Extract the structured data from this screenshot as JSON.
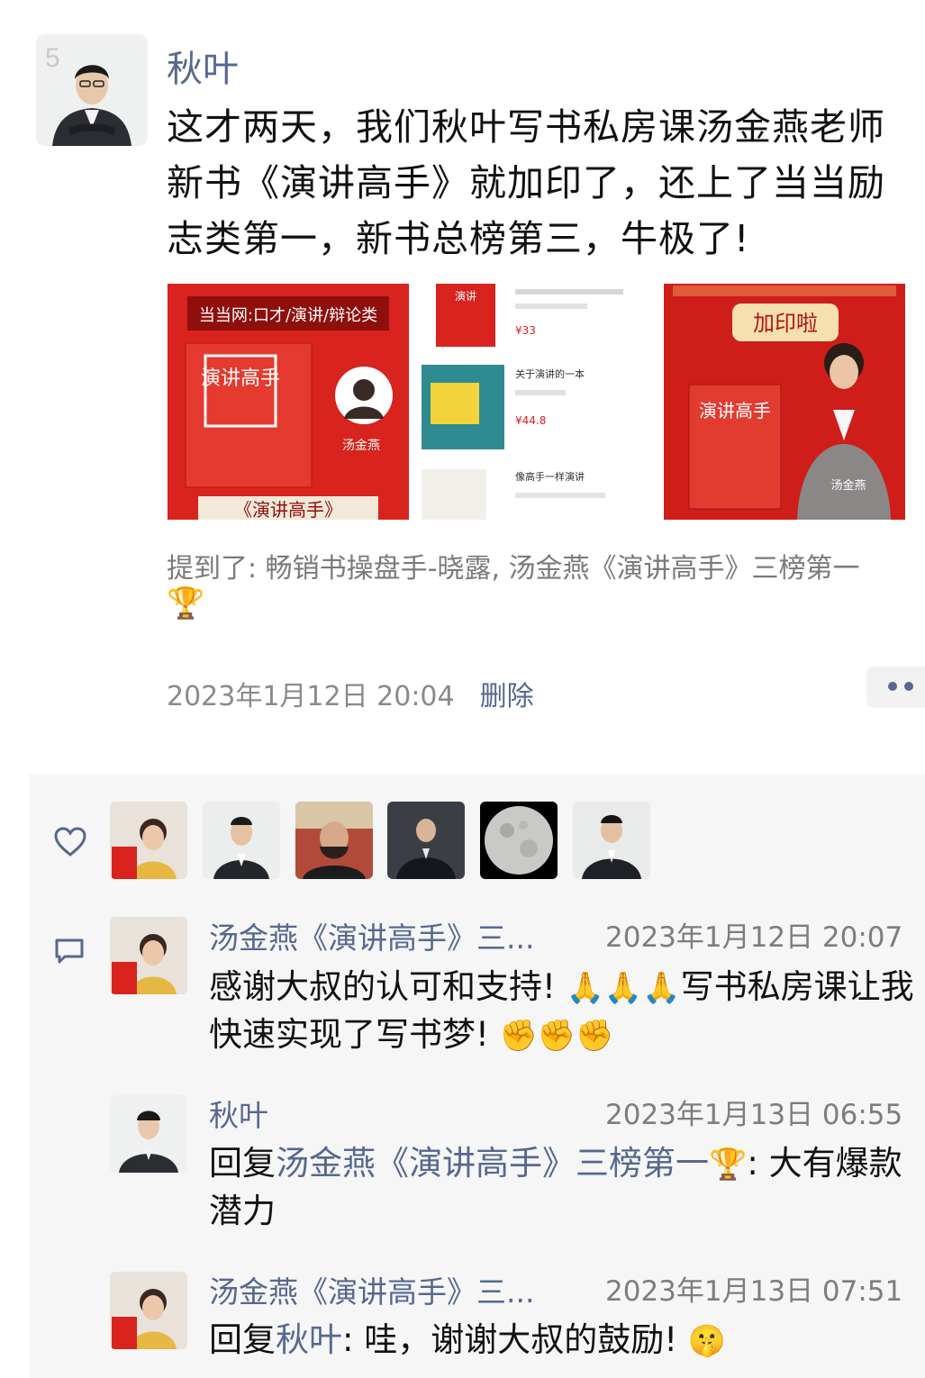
{
  "post": {
    "author": "秋叶",
    "avatar_badge": "5",
    "text": "这才两天，我们秋叶写书私房课汤金燕老师新书《演讲高手》就加印了，还上了当当励志类第一，新书总榜第三，牛极了!",
    "images": [
      {
        "banner": "当当网:口才/演讲/辩论类",
        "book_title": "演讲高手",
        "author": "汤金燕",
        "caption": "《演讲高手》"
      },
      {
        "items": [
          {
            "label": "演讲",
            "price": "¥33"
          },
          {
            "label": "关于演讲的一本",
            "price": "¥44.8"
          },
          {
            "label": "像高手一样演讲",
            "price": ""
          }
        ]
      },
      {
        "stamp": "加印啦",
        "book_title": "演讲高手",
        "author": "汤金燕"
      }
    ],
    "mention": "提到了:  畅销书操盘手-晓露, 汤金燕《演讲高手》三榜第一",
    "trophy": "🏆",
    "timestamp": "2023年1月12日 20:04",
    "delete_label": "删除"
  },
  "likes": {
    "icon": "heart-outline-icon",
    "avatars": [
      "liker-1",
      "liker-2",
      "liker-3",
      "liker-4",
      "liker-5",
      "liker-6"
    ]
  },
  "comments": [
    {
      "name": "汤金燕《演讲高手》三...",
      "time": "2023年1月12日 20:07",
      "text": "感谢大叔的认可和支持! ",
      "emoji1": "🙏🙏🙏",
      "text2": "写书私房课让我快速实现了写书梦! ",
      "emoji2": "✊✊✊"
    },
    {
      "name": "秋叶",
      "time": "2023年1月13日 06:55",
      "reply_prefix": "回复",
      "reply_to": "汤金燕《演讲高手》三榜第一",
      "trophy": "🏆",
      "text": ": 大有爆款潜力"
    },
    {
      "name": "汤金燕《演讲高手》三...",
      "time": "2023年1月13日 07:51",
      "reply_prefix": "回复",
      "reply_to": "秋叶",
      "text": ": 哇，谢谢大叔的鼓励! ",
      "emoji": "🤫"
    }
  ],
  "colors": {
    "link": "#56688f",
    "book_red": "#d8231e",
    "panel": "#f6f6f6"
  }
}
